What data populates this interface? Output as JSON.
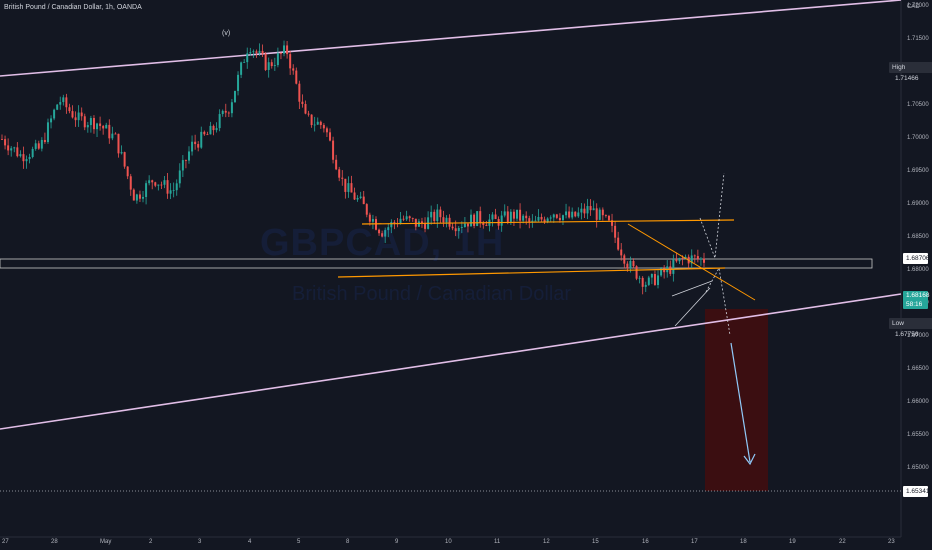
{
  "header": {
    "title": "British Pound / Canadian Dollar, 1h, OANDA",
    "currency": "CAD"
  },
  "watermark": {
    "symbol": "GBPCAD, 1H",
    "name": "British Pound / Canadian Dollar"
  },
  "annotations": {
    "wave_label": "(v)"
  },
  "price_badges": {
    "high_label": "High",
    "high_value": "1.71466",
    "zone_value": "1.68706",
    "current_value": "1.68168",
    "current_time": "58:16",
    "low_label": "Low",
    "low_value": "1.67756",
    "target_value": "1.65341"
  },
  "colors": {
    "background": "#131722",
    "up": "#26a69a",
    "down": "#ef5350",
    "channel": "#e1bee7",
    "pattern": "#ff9800",
    "target_zone": "#3b0e11",
    "arrow": "#90caf9"
  },
  "chart_data": {
    "type": "candlestick",
    "title": "British Pound / Canadian Dollar, 1h, OANDA",
    "y_axis": {
      "unit": "CAD",
      "range": [
        1.645,
        1.725
      ],
      "ticks": [
        "1.72000",
        "1.71500",
        "1.71000",
        "1.70500",
        "1.70000",
        "1.69500",
        "1.69000",
        "1.68500",
        "1.68000",
        "1.67500",
        "1.67000",
        "1.66500",
        "1.66000",
        "1.65500",
        "1.65000"
      ]
    },
    "x_axis": {
      "ticks": [
        "27",
        "28",
        "May",
        "2",
        "3",
        "4",
        "5",
        "8",
        "9",
        "10",
        "11",
        "12",
        "15",
        "16",
        "17",
        "18",
        "19",
        "22",
        "23"
      ]
    },
    "path_closes": [
      [
        0,
        1.7
      ],
      [
        1,
        1.6975
      ],
      [
        2,
        1.6985
      ],
      [
        3,
        1.706
      ],
      [
        4,
        1.703
      ],
      [
        5,
        1.7025
      ],
      [
        6,
        1.7
      ],
      [
        7,
        1.691
      ],
      [
        8,
        1.694
      ],
      [
        9,
        1.692
      ],
      [
        10,
        1.699
      ],
      [
        11,
        1.701
      ],
      [
        12,
        1.705
      ],
      [
        13,
        1.7145
      ],
      [
        14,
        1.711
      ],
      [
        15,
        1.7135
      ],
      [
        16,
        1.703
      ],
      [
        17,
        1.702
      ],
      [
        18,
        1.693
      ],
      [
        19,
        1.69
      ],
      [
        20,
        1.686
      ],
      [
        21,
        1.688
      ],
      [
        22,
        1.687
      ],
      [
        23,
        1.6885
      ],
      [
        24,
        1.687
      ],
      [
        25,
        1.688
      ],
      [
        26,
        1.6875
      ],
      [
        27,
        1.6885
      ],
      [
        28,
        1.687
      ],
      [
        29,
        1.689
      ],
      [
        30,
        1.688
      ],
      [
        31,
        1.6895
      ],
      [
        32,
        1.687
      ],
      [
        33,
        1.681
      ],
      [
        34,
        1.678
      ],
      [
        35,
        1.68
      ],
      [
        36,
        1.682
      ],
      [
        37,
        1.6817
      ]
    ],
    "high": 1.71466,
    "low": 1.67756,
    "last": 1.68168,
    "zone": 1.68706,
    "target": 1.65341
  }
}
